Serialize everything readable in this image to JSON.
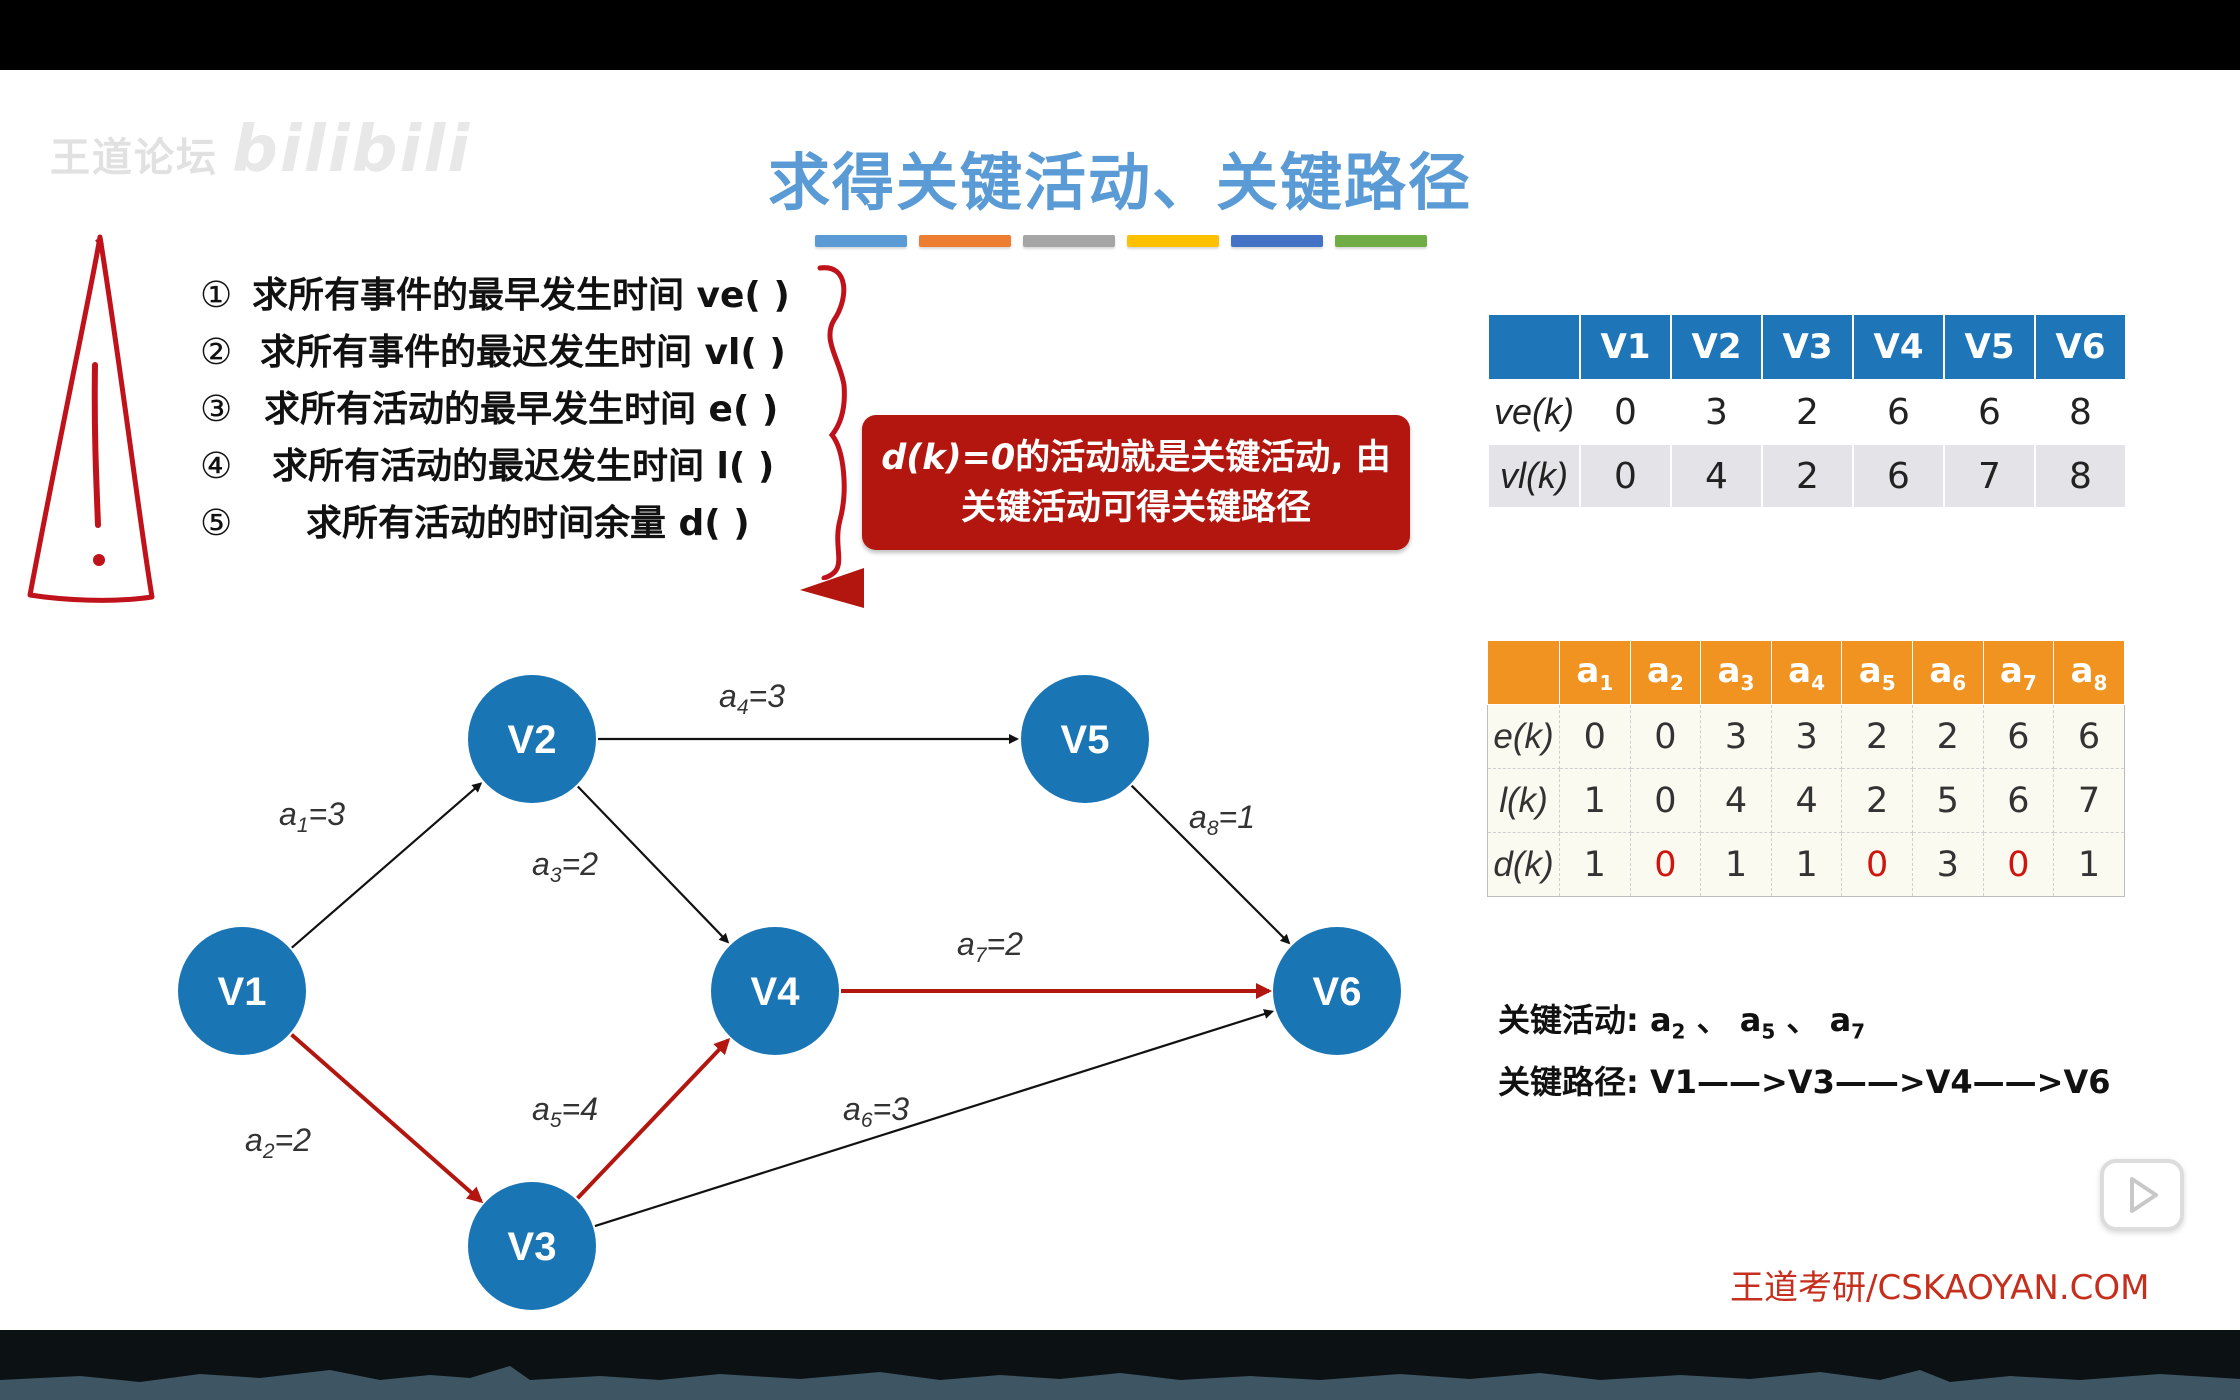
{
  "slide": {
    "title": "求得关键活动、关键路径",
    "watermark": "王道论坛",
    "watermark_logo": "bilibili",
    "title_bar_colors": [
      "#5b9bd5",
      "#ed7d31",
      "#a5a5a5",
      "#ffc000",
      "#4472c4",
      "#70ad47"
    ],
    "steps": [
      {
        "num": "①",
        "text": "求所有事件的最早发生时间 ve( )"
      },
      {
        "num": "②",
        "text": "求所有事件的最迟发生时间 vl( )"
      },
      {
        "num": "③",
        "text": "求所有活动的最早发生时间 e( )"
      },
      {
        "num": "④",
        "text": "求所有活动的最迟发生时间 l( )"
      },
      {
        "num": "⑤",
        "text": "求所有活动的时间余量 d( )"
      }
    ],
    "callout": {
      "line1_em": "d(k)=0",
      "line1_rest": "的活动就是关键活动, 由",
      "line2": "关键活动可得关键路径"
    },
    "graph": {
      "nodes": [
        "V1",
        "V2",
        "V3",
        "V4",
        "V5",
        "V6"
      ],
      "edges": [
        {
          "name": "a",
          "sub": "1",
          "value": "=3",
          "from": "V1",
          "to": "V2",
          "critical": false
        },
        {
          "name": "a",
          "sub": "2",
          "value": "=2",
          "from": "V1",
          "to": "V3",
          "critical": true
        },
        {
          "name": "a",
          "sub": "3",
          "value": "=2",
          "from": "V2",
          "to": "V4",
          "critical": false
        },
        {
          "name": "a",
          "sub": "4",
          "value": "=3",
          "from": "V2",
          "to": "V5",
          "critical": false
        },
        {
          "name": "a",
          "sub": "5",
          "value": "=4",
          "from": "V3",
          "to": "V4",
          "critical": true
        },
        {
          "name": "a",
          "sub": "6",
          "value": "=3",
          "from": "V3",
          "to": "V6",
          "critical": false
        },
        {
          "name": "a",
          "sub": "7",
          "value": "=2",
          "from": "V4",
          "to": "V6",
          "critical": true
        },
        {
          "name": "a",
          "sub": "8",
          "value": "=1",
          "from": "V5",
          "to": "V6",
          "critical": false
        }
      ],
      "node_color": "#1a75b5",
      "critical_color": "#b3160f"
    },
    "event_table": {
      "headers": [
        "V1",
        "V2",
        "V3",
        "V4",
        "V5",
        "V6"
      ],
      "rows": [
        {
          "label": "ve(k)",
          "values": [
            "0",
            "3",
            "2",
            "6",
            "6",
            "8"
          ]
        },
        {
          "label": "vl(k)",
          "values": [
            "0",
            "4",
            "2",
            "6",
            "7",
            "8"
          ]
        }
      ]
    },
    "activity_table": {
      "headers": [
        {
          "name": "a",
          "sub": "1"
        },
        {
          "name": "a",
          "sub": "2"
        },
        {
          "name": "a",
          "sub": "3"
        },
        {
          "name": "a",
          "sub": "4"
        },
        {
          "name": "a",
          "sub": "5"
        },
        {
          "name": "a",
          "sub": "6"
        },
        {
          "name": "a",
          "sub": "7"
        },
        {
          "name": "a",
          "sub": "8"
        }
      ],
      "rows": [
        {
          "label": "e(k)",
          "values": [
            "0",
            "0",
            "3",
            "3",
            "2",
            "2",
            "6",
            "6"
          ]
        },
        {
          "label": "l(k)",
          "values": [
            "1",
            "0",
            "4",
            "4",
            "2",
            "5",
            "6",
            "7"
          ]
        },
        {
          "label": "d(k)",
          "values": [
            "1",
            "0",
            "1",
            "1",
            "0",
            "3",
            "0",
            "1"
          ]
        }
      ]
    },
    "result": {
      "activities_label": "关键活动:",
      "activities": [
        {
          "name": "a",
          "sub": "2"
        },
        {
          "name": "a",
          "sub": "5"
        },
        {
          "name": "a",
          "sub": "7"
        }
      ],
      "activities_sep": " 、",
      "path_label": "关键路径:",
      "path": "V1——>V3——>V4——>V6"
    },
    "brand": "王道考研/CSKAOYAN.COM"
  },
  "player": {
    "play_icon": "play-icon"
  }
}
